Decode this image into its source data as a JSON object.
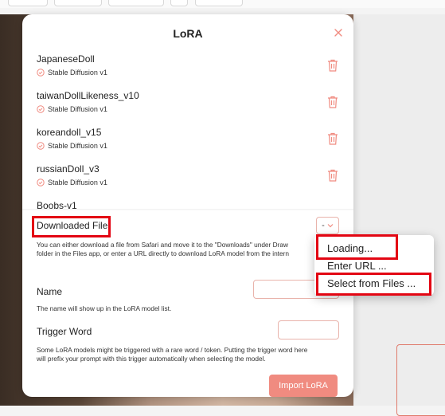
{
  "modal": {
    "title": "LoRA",
    "items": [
      {
        "name": "JapaneseDoll",
        "base": "Stable Diffusion v1"
      },
      {
        "name": "taiwanDollLikeness_v10",
        "base": "Stable Diffusion v1"
      },
      {
        "name": "koreandoll_v15",
        "base": "Stable Diffusion v1"
      },
      {
        "name": "russianDoll_v3",
        "base": "Stable Diffusion v1"
      },
      {
        "name": "Boobs-v1",
        "base": ""
      }
    ]
  },
  "form": {
    "downloaded_file_label": "Downloaded File",
    "downloaded_file_value": "-",
    "download_help_line1": "You can either download a file from Safari and move it to the \"Downloads\" under Draw",
    "download_help_line2": "folder in the Files app, or enter a URL directly to download LoRA model from the intern",
    "name_label": "Name",
    "name_value": "",
    "name_help": "The name will show up in the LoRA model list.",
    "trigger_label": "Trigger Word",
    "trigger_value": "",
    "trigger_help_line1": "Some LoRA models might be triggered with a rare word / token. Putting the trigger word here",
    "trigger_help_line2": "will prefix your prompt with this trigger automatically when selecting the model.",
    "import_button": "Import LoRA"
  },
  "menu": {
    "items": [
      "Loading...",
      "Enter URL ...",
      "Select from Files ..."
    ]
  },
  "colors": {
    "accent": "#f08b80",
    "highlight": "#e30613"
  }
}
